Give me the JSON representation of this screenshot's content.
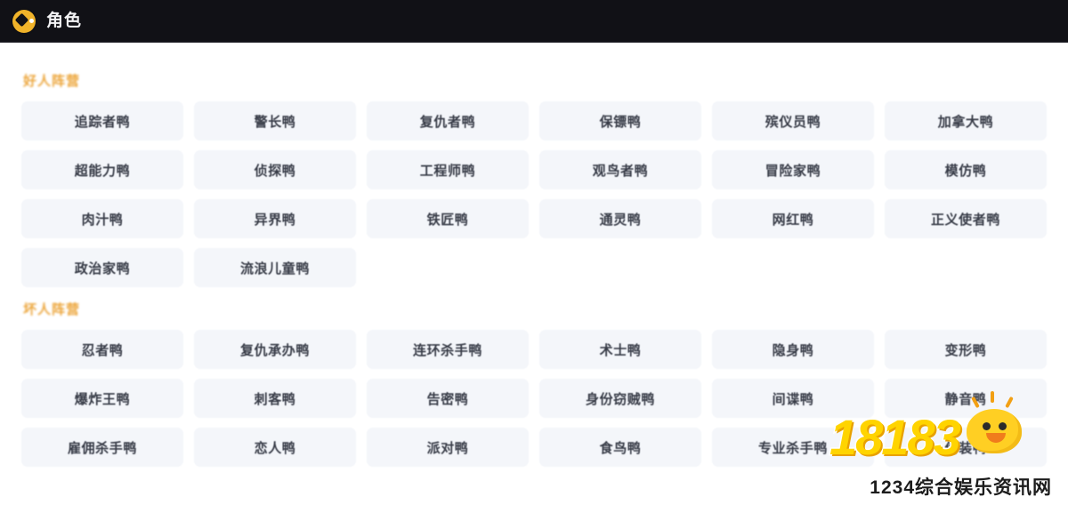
{
  "header": {
    "title": "角色",
    "icon": "goose-duck-logo-icon",
    "background_color": "#111116",
    "title_color": "#f2f2f4",
    "icon_color": "#f0b32a"
  },
  "sections": [
    {
      "id": "good-camp",
      "title": "好人阵营",
      "title_color": "#f2a93b",
      "tags": [
        "追踪者鸭",
        "警长鸭",
        "复仇者鸭",
        "保镖鸭",
        "殡仪员鸭",
        "加拿大鸭",
        "超能力鸭",
        "侦探鸭",
        "工程师鸭",
        "观鸟者鸭",
        "冒险家鸭",
        "模仿鸭",
        "肉汁鸭",
        "异界鸭",
        "铁匠鸭",
        "通灵鸭",
        "网红鸭",
        "正义使者鸭",
        "政治家鸭",
        "流浪儿童鸭"
      ]
    },
    {
      "id": "bad-camp",
      "title": "坏人阵营",
      "title_color": "#f2a93b",
      "tags": [
        "忍者鸭",
        "复仇承办鸭",
        "连环杀手鸭",
        "术士鸭",
        "隐身鸭",
        "变形鸭",
        "爆炸王鸭",
        "刺客鸭",
        "告密鸭",
        "身份窃贼鸭",
        "间谍鸭",
        "静音鸭",
        "雇佣杀手鸭",
        "恋人鸭",
        "派对鸭",
        "食鸟鸭",
        "专业杀手鸭",
        "伪装鸭"
      ]
    }
  ],
  "tag_style": {
    "background_color": "#eef0f4",
    "text_color": "#3b3f4a"
  },
  "watermarks": {
    "logo_text": "18183",
    "logo_color": "#ffd400",
    "bottom_text": "1234综合娱乐资讯网",
    "bottom_color": "#1c1c1c"
  }
}
